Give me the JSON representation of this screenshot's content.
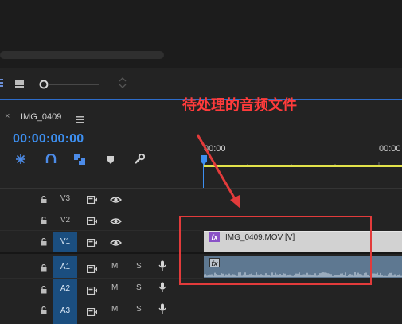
{
  "annotation": {
    "text": "待处理的音频文件",
    "color": "#ff3b3b"
  },
  "sequence": {
    "tab_name": "IMG_0409",
    "timecode": "00:00:00:00",
    "ruler": [
      "00:00",
      "00:00"
    ]
  },
  "tracks": [
    {
      "label": "V3",
      "type": "video"
    },
    {
      "label": "V2",
      "type": "video"
    },
    {
      "label": "V1",
      "type": "video",
      "selected": true
    },
    {
      "label": "A1",
      "type": "audio",
      "selected": true
    },
    {
      "label": "A2",
      "type": "audio",
      "selected": true
    },
    {
      "label": "A3",
      "type": "audio",
      "selected": true
    }
  ],
  "audio_buttons": {
    "mute": "M",
    "solo": "S"
  },
  "clips": {
    "video": {
      "label": "IMG_0409.MOV [V]",
      "fx": "fx"
    },
    "audio": {
      "fx": "fx"
    }
  },
  "colors": {
    "accent": "#2d6cc9",
    "playhead": "#2d6cc9",
    "work_area": "#e2e24a",
    "highlight_box": "#e23b3b",
    "video_clip": "#d2d2d2",
    "audio_clip": "#5e7891"
  }
}
